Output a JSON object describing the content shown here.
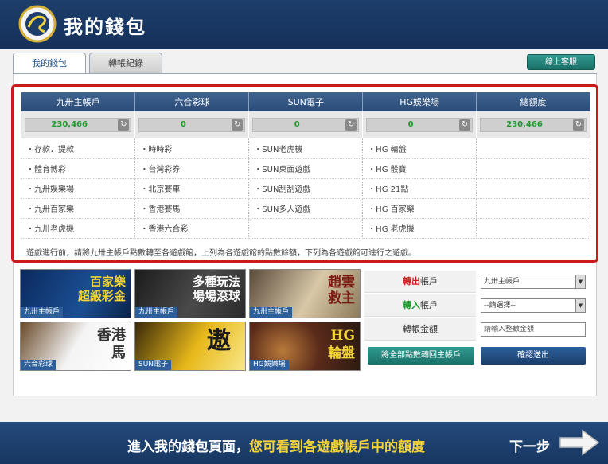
{
  "header": {
    "title": "我的錢包"
  },
  "tabs": [
    {
      "label": "我的錢包"
    },
    {
      "label": "轉帳紀錄"
    }
  ],
  "cs_button": "線上客服",
  "accounts": [
    {
      "name": "九卅主帳戶",
      "balance": "230,466",
      "games": [
        "存款．提款",
        "體育博彩",
        "九卅娛樂場",
        "九卅百家樂",
        "九卅老虎機"
      ]
    },
    {
      "name": "六合彩球",
      "balance": "0",
      "games": [
        "時時彩",
        "台灣彩券",
        "北京賽車",
        "香港賽馬",
        "香港六合彩"
      ]
    },
    {
      "name": "SUN電子",
      "balance": "0",
      "games": [
        "SUN老虎機",
        "SUN桌面遊戲",
        "SUN刮刮遊戲",
        "SUN多人遊戲",
        ""
      ]
    },
    {
      "name": "HG娛樂場",
      "balance": "0",
      "games": [
        "HG 輪盤",
        "HG 骰寶",
        "HG 21點",
        "HG 百家樂",
        "HG 老虎機"
      ]
    },
    {
      "name": "總額度",
      "balance": "230,466",
      "games": [
        "",
        "",
        "",
        "",
        ""
      ]
    }
  ],
  "note": "遊戲進行前，請將九卅主帳戶點數轉至各遊戲館，上列為各遊戲館的點數餘額，下列為各遊戲館可進行之遊戲。",
  "banners": [
    {
      "text1": "百家樂",
      "text2": "超級彩金",
      "caption": "九卅主帳戶"
    },
    {
      "text1": "多種玩法",
      "text2": "場場滾球",
      "caption": "九卅主帳戶"
    },
    {
      "text1": "趙雲",
      "text2": "救主",
      "caption": "九卅主帳戶"
    },
    {
      "text1": "香港",
      "text2": "馬",
      "caption": "六合彩球"
    },
    {
      "text1": "遨",
      "text2": "",
      "caption": "SUN電子"
    },
    {
      "text1": "HG",
      "text2": "輪盤",
      "caption": "HG娛樂場"
    }
  ],
  "form": {
    "out_label_a": "轉出",
    "out_label_b": "帳戶",
    "out_value": "九卅主帳戶",
    "in_label_a": "轉入",
    "in_label_b": "帳戶",
    "in_value": "--請選擇--",
    "amount_label": "轉帳金額",
    "amount_placeholder": "請輸入整數金額",
    "back_button": "將全部點數轉回主帳戶",
    "ok_button": "確認送出"
  },
  "footer": {
    "msg_a": "進入我的錢包頁面，",
    "msg_b": "您可看到各遊戲帳戶中的額度",
    "next": "下一步"
  }
}
